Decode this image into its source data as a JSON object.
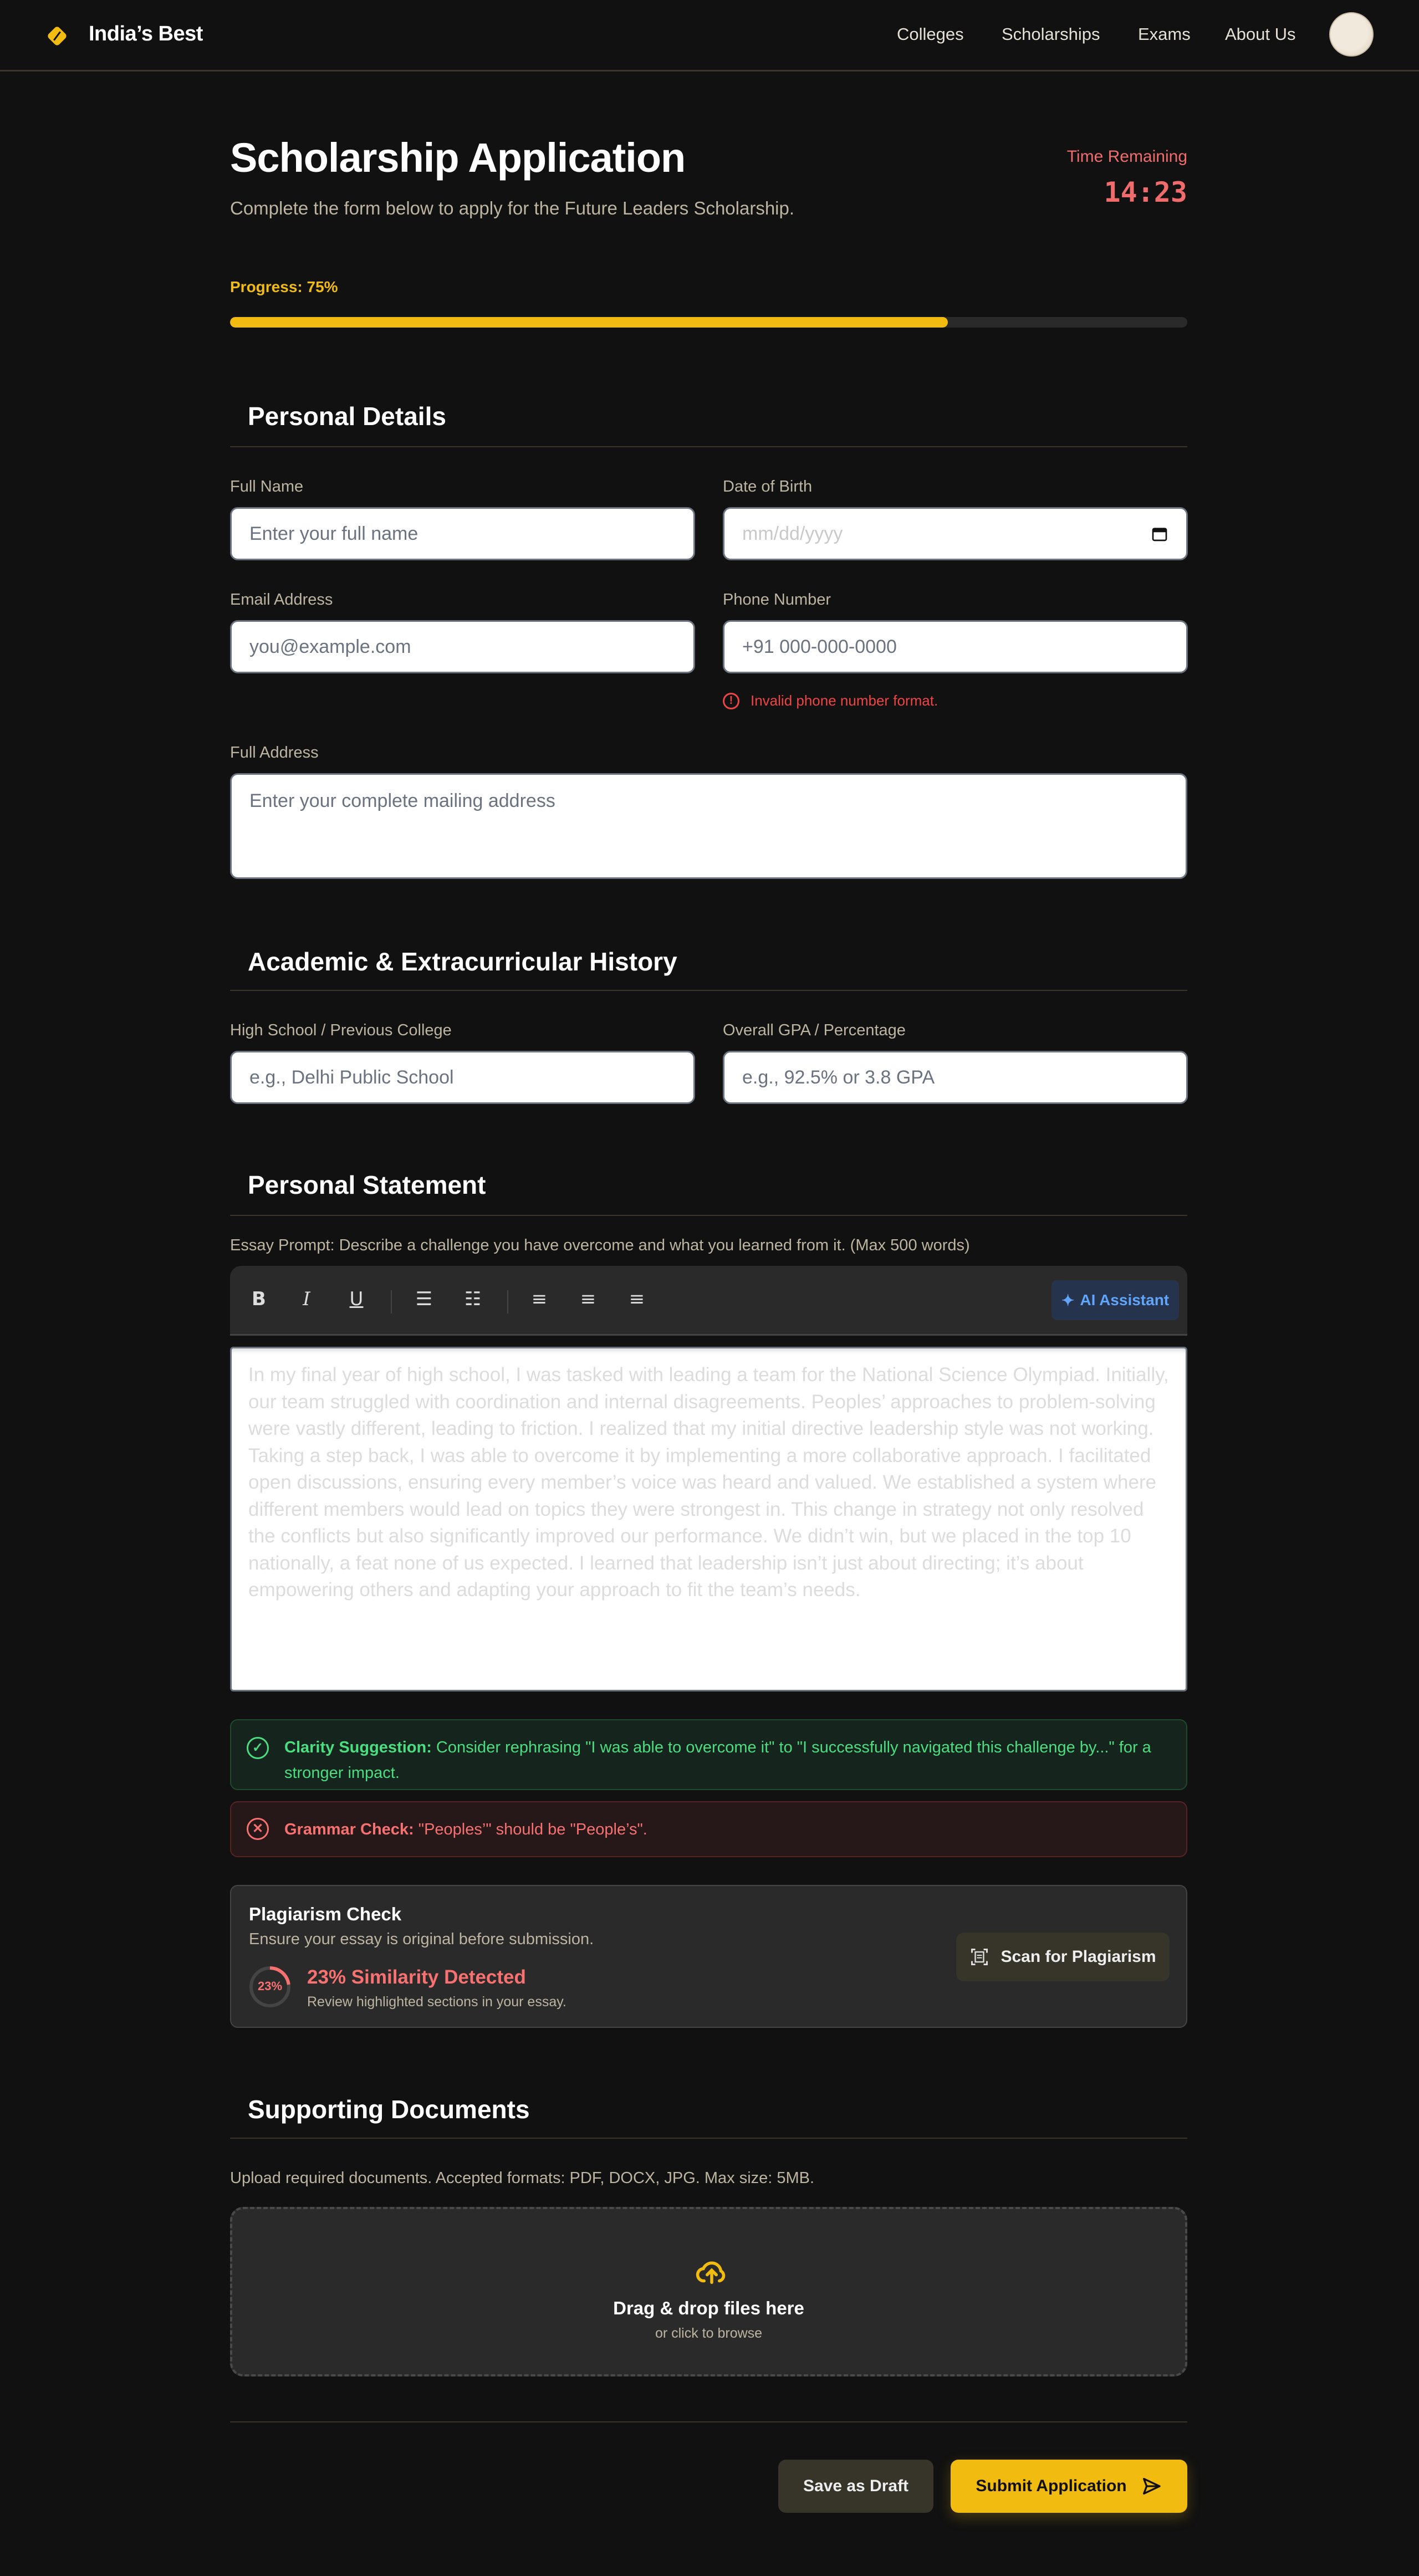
{
  "header": {
    "brand": "India’s Best",
    "nav": [
      "Colleges",
      "Scholarships",
      "Exams",
      "About Us"
    ],
    "accent_color": "#f2bb0f"
  },
  "page": {
    "title": "Scholarship Application",
    "subtitle": "Complete the form below to apply for the Future Leaders Scholarship.",
    "time_label": "Time Remaining",
    "time_value": "14:23",
    "progress_label": "Progress: 75%",
    "progress_percent": 75
  },
  "personal": {
    "heading": "Personal Details",
    "full_name_label": "Full Name",
    "full_name_placeholder": "Enter your full name",
    "dob_label": "Date of Birth",
    "dob_placeholder": "mm/dd/yyyy",
    "email_label": "Email Address",
    "email_placeholder": "you@example.com",
    "phone_label": "Phone Number",
    "phone_placeholder": "+91 000-000-0000",
    "phone_error": "Invalid phone number format.",
    "address_label": "Full Address",
    "address_placeholder": "Enter your complete mailing address"
  },
  "academic": {
    "heading": "Academic & Extracurricular History",
    "school_label": "High School / Previous College",
    "school_placeholder": "e.g., Delhi Public School",
    "gpa_label": "Overall GPA / Percentage",
    "gpa_placeholder": "e.g., 92.5% or 3.8 GPA"
  },
  "statement": {
    "heading": "Personal Statement",
    "prompt": "Essay Prompt: Describe a challenge you have overcome and what you learned from it. (Max 500 words)",
    "toolbar": {
      "bold": "B",
      "italic": "I",
      "underline": "U",
      "ai_assistant": "AI Assistant"
    },
    "essay": "In my final year of high school, I was tasked with leading a team for the National Science Olympiad. Initially, our team struggled with coordination and internal disagreements. Peoples’ approaches to problem-solving were vastly different, leading to friction. I realized that my initial directive leadership style was not working. Taking a step back, I was able to overcome it by implementing a more collaborative approach. I facilitated open discussions, ensuring every member’s voice was heard and valued. We established a system where different members would lead on topics they were strongest in. This change in strategy not only resolved the conflicts but also significantly improved our performance. We didn’t win, but we placed in the top 10 nationally, a feat none of us expected. I learned that leadership isn’t just about directing; it’s about empowering others and adapting your approach to fit the team’s needs.",
    "clarity_title": "Clarity Suggestion:",
    "clarity_text": " Consider rephrasing \"I was able to overcome it\" to \"I successfully navigated this challenge by...\" for a stronger impact.",
    "grammar_title": "Grammar Check:",
    "grammar_text": " \"Peoples’\" should be \"People’s\".",
    "plagiarism": {
      "title": "Plagiarism Check",
      "subtitle": "Ensure your essay is original before submission.",
      "ring_label": "23%",
      "similarity_percent": 23,
      "result": "23% Similarity Detected",
      "hint": "Review highlighted sections in your essay.",
      "scan_button": "Scan for Plagiarism"
    }
  },
  "documents": {
    "heading": "Supporting Documents",
    "description": "Upload required documents. Accepted formats: PDF, DOCX, JPG. Max size: 5MB.",
    "drop_title": "Drag & drop files here",
    "drop_sub": "or click to browse"
  },
  "actions": {
    "save_draft": "Save as Draft",
    "submit": "Submit Application"
  }
}
